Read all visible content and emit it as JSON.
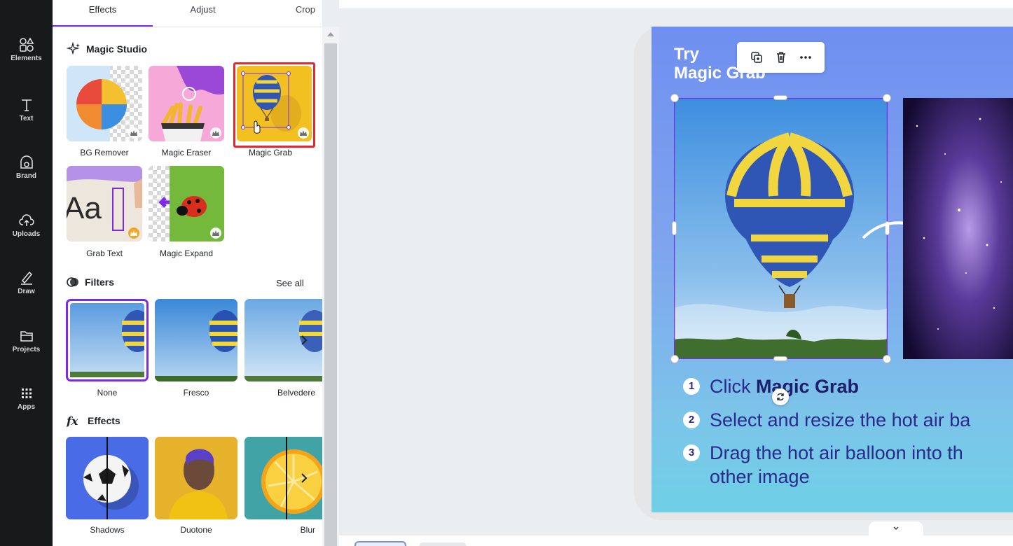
{
  "rail": {
    "items": [
      {
        "label": "Elements",
        "icon": "elements-icon"
      },
      {
        "label": "Text",
        "icon": "text-icon"
      },
      {
        "label": "Brand",
        "icon": "brand-icon"
      },
      {
        "label": "Uploads",
        "icon": "uploads-icon"
      },
      {
        "label": "Draw",
        "icon": "draw-icon"
      },
      {
        "label": "Projects",
        "icon": "projects-icon"
      },
      {
        "label": "Apps",
        "icon": "apps-icon"
      }
    ]
  },
  "panel": {
    "tabs": [
      {
        "label": "Effects",
        "active": true
      },
      {
        "label": "Adjust",
        "active": false
      },
      {
        "label": "Crop",
        "active": false
      }
    ],
    "magic_studio": {
      "title": "Magic Studio",
      "tools": [
        {
          "label": "BG Remover",
          "premium": true
        },
        {
          "label": "Magic Eraser",
          "premium": true
        },
        {
          "label": "Magic Grab",
          "premium": true,
          "selected": true
        },
        {
          "label": "Grab Text",
          "premium": true
        },
        {
          "label": "Magic Expand",
          "premium": true
        }
      ]
    },
    "filters": {
      "title": "Filters",
      "see_all": "See all",
      "items": [
        {
          "label": "None",
          "selected": true
        },
        {
          "label": "Fresco"
        },
        {
          "label": "Belvedere"
        }
      ]
    },
    "effects": {
      "title": "Effects",
      "items": [
        {
          "label": "Shadows"
        },
        {
          "label": "Duotone"
        },
        {
          "label": "Blur"
        }
      ]
    },
    "accent_color": "#7d2ae8",
    "highlight_color": "#e8262d"
  },
  "canvas": {
    "title_line1": "Try",
    "title_line2": "Magic Grab",
    "steps": [
      {
        "num": "1",
        "pre": "Click ",
        "bold": "Magic Grab",
        "post": ""
      },
      {
        "num": "2",
        "pre": "Select and resize the hot air ba",
        "bold": "",
        "post": ""
      },
      {
        "num": "3",
        "pre": "Drag the hot air balloon into th",
        "bold": "",
        "post": ""
      }
    ],
    "step3_line2": "other image"
  }
}
